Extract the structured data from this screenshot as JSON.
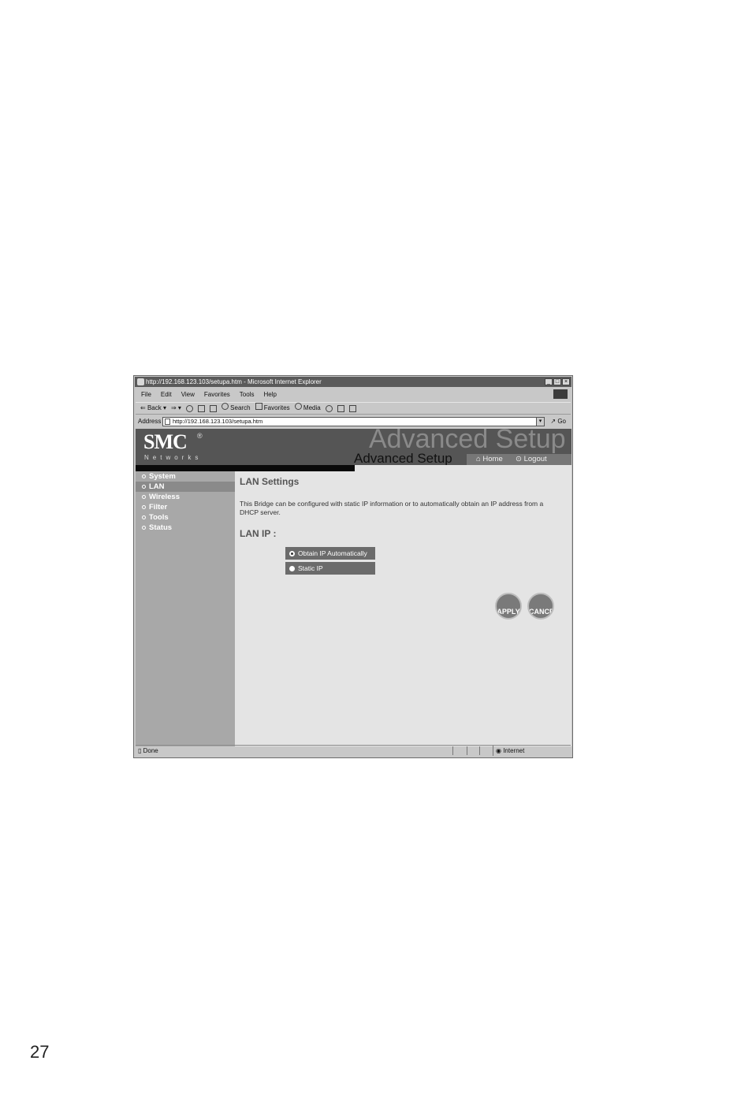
{
  "page_number": "27",
  "browser": {
    "title": "http://192.168.123.103/setupa.htm - Microsoft Internet Explorer",
    "window_buttons": [
      "_",
      "□",
      "×"
    ],
    "menu": [
      "File",
      "Edit",
      "View",
      "Favorites",
      "Tools",
      "Help"
    ],
    "toolbar": {
      "back": "Back",
      "search": "Search",
      "favorites": "Favorites",
      "media": "Media"
    },
    "address_label": "Address",
    "address_value": "http://192.168.123.103/setupa.htm",
    "go_label": "Go",
    "status_done": "Done",
    "status_zone": "Internet"
  },
  "header": {
    "logo": "SMC",
    "logo_reg": "®",
    "logo_sub": "Networks",
    "ghost_title": "Advanced Setup",
    "title": "Advanced Setup",
    "home_label": "Home",
    "logout_label": "Logout"
  },
  "nav": {
    "items": [
      "System",
      "LAN",
      "Wireless",
      "Filter",
      "Tools",
      "Status"
    ],
    "active": "LAN"
  },
  "main": {
    "heading": "LAN Settings",
    "description": "This Bridge can be configured with static IP information or to automatically obtain an IP address from a DHCP server.",
    "lan_ip_label": "LAN IP :",
    "options": [
      "Obtain IP Automatically",
      "Static IP"
    ],
    "selected_option": "Obtain IP Automatically",
    "apply_label": "APPLY",
    "cancel_label": "CANCEL"
  }
}
